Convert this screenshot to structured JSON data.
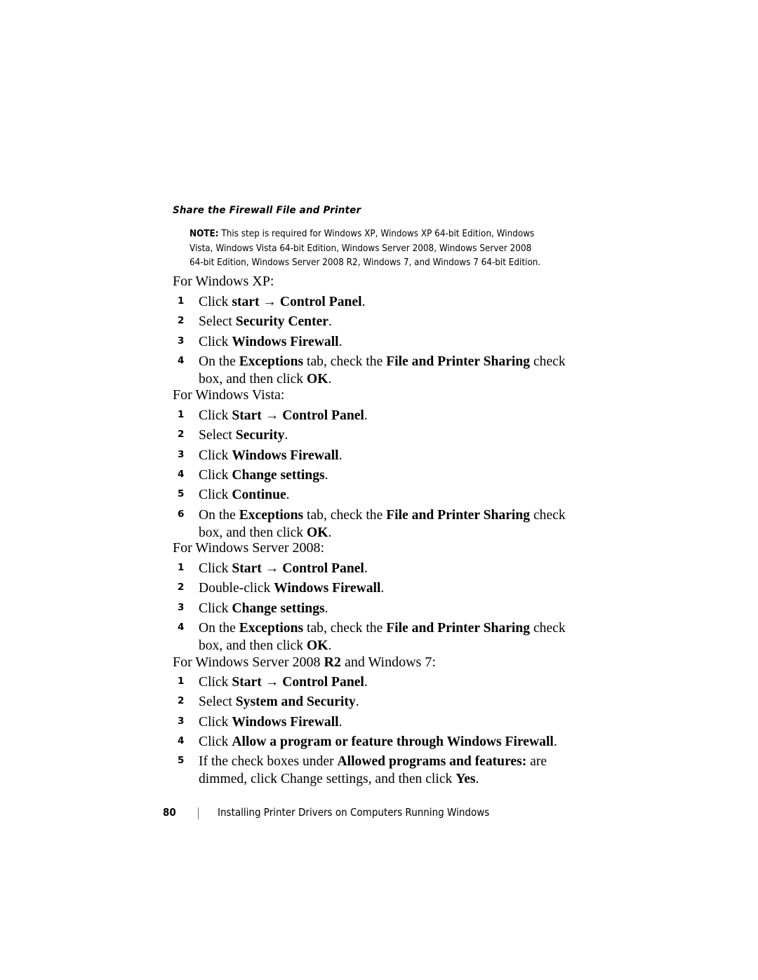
{
  "document": {
    "section_heading": "Share the Firewall File and Printer",
    "note": {
      "label": "NOTE:",
      "text": " This step is required for Windows XP, Windows XP 64-bit Edition, Windows Vista, Windows Vista 64-bit Edition, Windows Server 2008, Windows Server 2008 64-bit Edition, Windows Server 2008 R2, Windows 7, and Windows 7 64-bit Edition."
    },
    "procedures": [
      {
        "intro": "For Windows XP:",
        "steps": [
          {
            "num": "1",
            "html": "Click <b>start</b> &rarr; <b>Control Panel</b>."
          },
          {
            "num": "2",
            "html": "Select <b>Security Center</b>."
          },
          {
            "num": "3",
            "html": "Click <b>Windows Firewall</b>."
          },
          {
            "num": "4",
            "html": "On the <b>Exceptions</b> tab, check the <b>File and Printer Sharing</b> check box, and then click <b>OK</b>."
          }
        ]
      },
      {
        "intro": "For Windows Vista:",
        "steps": [
          {
            "num": "1",
            "html": "Click <b>Start</b> &rarr; <b>Control Panel</b>."
          },
          {
            "num": "2",
            "html": "Select <b>Security</b>."
          },
          {
            "num": "3",
            "html": "Click <b>Windows Firewall</b>."
          },
          {
            "num": "4",
            "html": "Click <b>Change settings</b>."
          },
          {
            "num": "5",
            "html": "Click <b>Continue</b>."
          },
          {
            "num": "6",
            "html": "On the <b>Exceptions</b> tab, check the <b>File and Printer Sharing</b> check box, and then click <b>OK</b>."
          }
        ]
      },
      {
        "intro": "For Windows Server 2008:",
        "steps": [
          {
            "num": "1",
            "html": "Click <b>Start</b> &rarr; <b>Control Panel</b>."
          },
          {
            "num": "2",
            "html": "Double-click <b>Windows Firewall</b>."
          },
          {
            "num": "3",
            "html": "Click <b>Change settings</b>."
          },
          {
            "num": "4",
            "html": "On the <b>Exceptions</b> tab, check the <b>File and Printer Sharing</b> check box, and then click <b>OK</b>."
          }
        ]
      },
      {
        "intro": "For Windows Server 2008 <b>R2</b> and Windows 7:",
        "steps": [
          {
            "num": "1",
            "html": "Click <b>Start</b> &rarr; <b>Control Panel</b>."
          },
          {
            "num": "2",
            "html": "Select <b>System and Security</b>."
          },
          {
            "num": "3",
            "html": "Click <b>Windows Firewall</b>."
          },
          {
            "num": "4",
            "html": "Click <b>Allow a program or feature through Windows Firewall</b>."
          },
          {
            "num": "5",
            "html": "If the check boxes under <b>Allowed programs and features:</b> are dimmed, click Change settings, and then click <b>Yes</b>."
          }
        ]
      }
    ],
    "footer": {
      "page_number": "80",
      "separator": "|",
      "chapter_title": "Installing Printer Drivers on Computers Running Windows"
    }
  }
}
